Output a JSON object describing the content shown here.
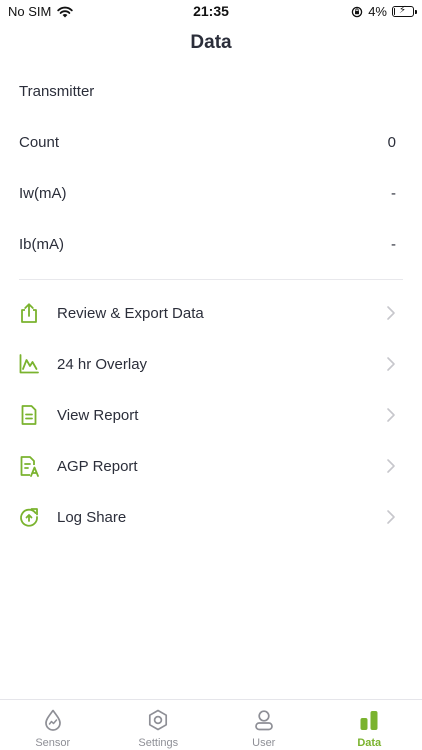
{
  "status_bar": {
    "carrier": "No SIM",
    "time": "21:35",
    "battery_percent": "4%",
    "battery_level": 0.04
  },
  "header": {
    "title": "Data"
  },
  "data_rows": [
    {
      "label": "Transmitter",
      "value": ""
    },
    {
      "label": "Count",
      "value": "0"
    },
    {
      "label": "Iw(mA)",
      "value": "-"
    },
    {
      "label": "Ib(mA)",
      "value": "-"
    }
  ],
  "menu": [
    {
      "label": "Review & Export Data",
      "icon": "export-icon"
    },
    {
      "label": "24 hr Overlay",
      "icon": "line-chart-icon"
    },
    {
      "label": "View Report",
      "icon": "document-icon"
    },
    {
      "label": "AGP Report",
      "icon": "agp-report-icon"
    },
    {
      "label": "Log Share",
      "icon": "share-refresh-icon"
    }
  ],
  "tabs": [
    {
      "label": "Sensor",
      "icon": "sensor-drop-icon",
      "active": false
    },
    {
      "label": "Settings",
      "icon": "settings-gear-icon",
      "active": false
    },
    {
      "label": "User",
      "icon": "user-icon",
      "active": false
    },
    {
      "label": "Data",
      "icon": "bar-chart-icon",
      "active": true
    }
  ],
  "colors": {
    "accent": "#7ab32e",
    "text": "#2b2e3a",
    "inactive_tab": "#8e8f96",
    "chevron": "#c7c7cc"
  }
}
